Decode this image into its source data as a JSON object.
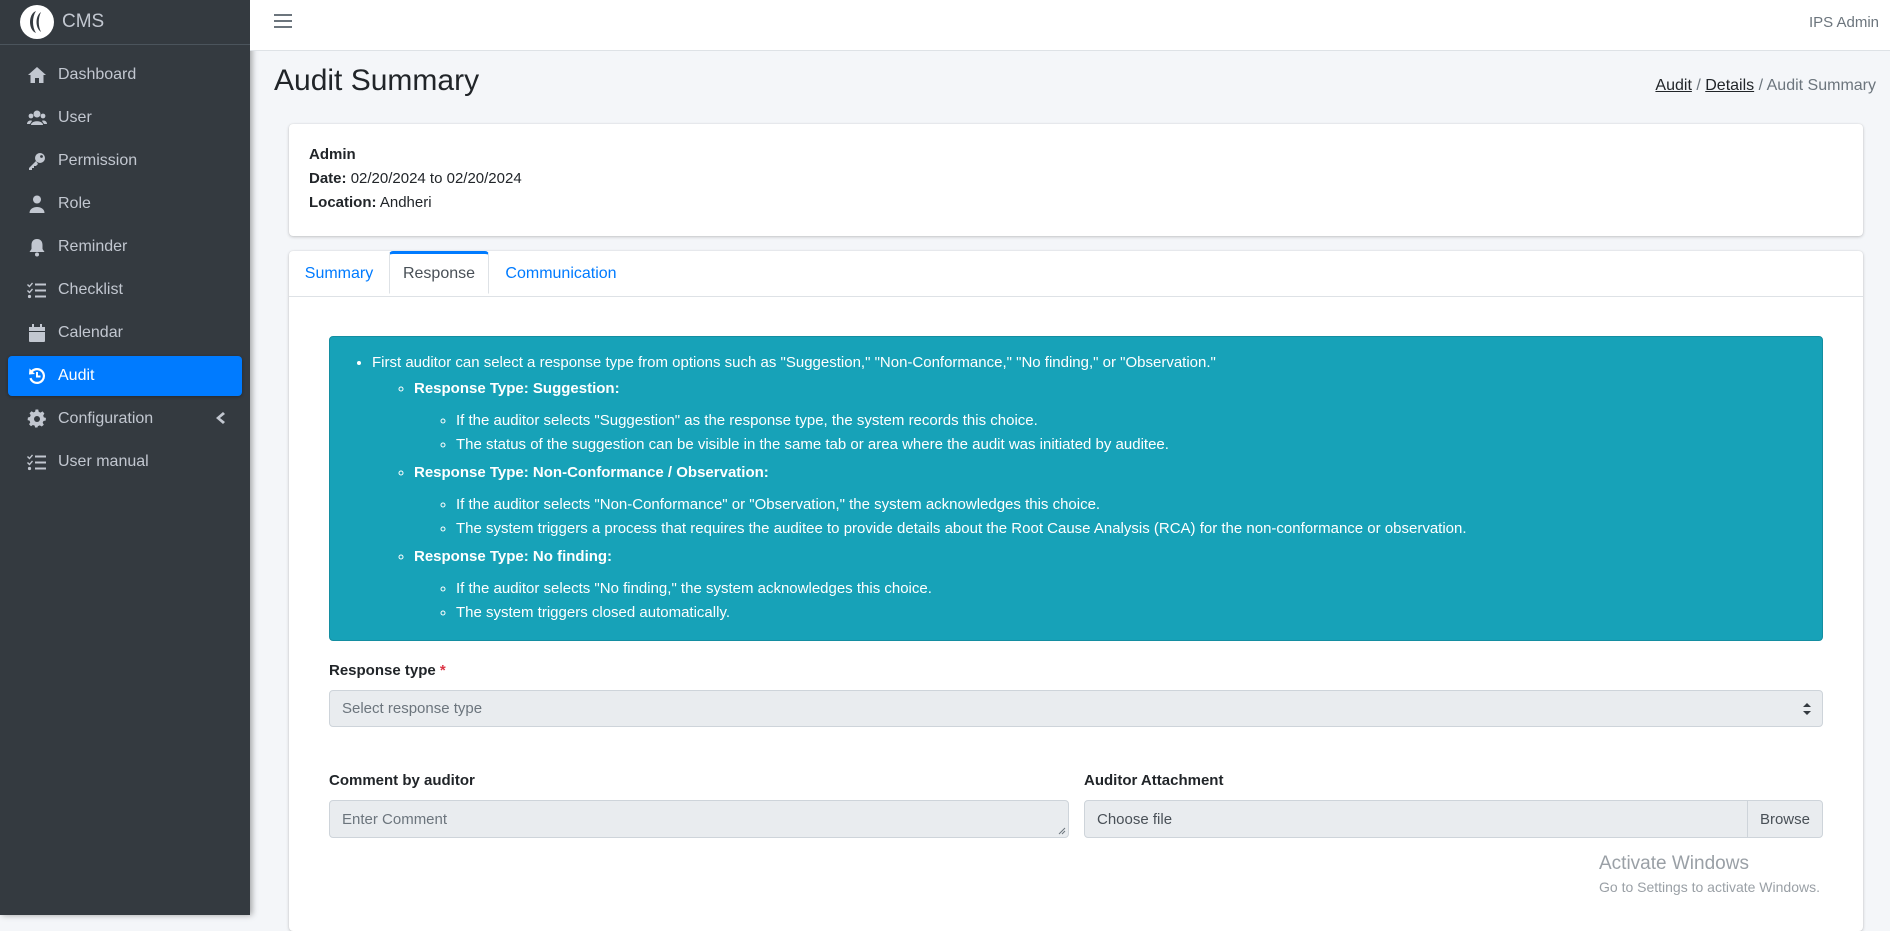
{
  "brand": {
    "name": "CMS"
  },
  "sidebar": {
    "items": [
      {
        "label": "Dashboard",
        "icon": "home-icon"
      },
      {
        "label": "User",
        "icon": "users-icon"
      },
      {
        "label": "Permission",
        "icon": "key-icon"
      },
      {
        "label": "Role",
        "icon": "user-icon"
      },
      {
        "label": "Reminder",
        "icon": "bell-icon"
      },
      {
        "label": "Checklist",
        "icon": "list-check-icon"
      },
      {
        "label": "Calendar",
        "icon": "calendar-icon"
      },
      {
        "label": "Audit",
        "icon": "history-icon",
        "active": true
      },
      {
        "label": "Configuration",
        "icon": "gear-icon"
      },
      {
        "label": "User manual",
        "icon": "list-check-icon"
      }
    ]
  },
  "header": {
    "user": "IPS Admin"
  },
  "page": {
    "title": "Audit Summary",
    "breadcrumb": {
      "audit": "Audit",
      "sep1": "/",
      "details": "Details",
      "sep2": "/",
      "current": "Audit Summary"
    }
  },
  "info": {
    "name": "Admin",
    "date_label": "Date:",
    "date_value": "02/20/2024 to 02/20/2024",
    "location_label": "Location:",
    "location_value": "Andheri"
  },
  "tabs": {
    "summary": "Summary",
    "response": "Response",
    "communication": "Communication"
  },
  "alert": {
    "intro": "First auditor can select a response type from options such as \"Suggestion,\" \"Non-Conformance,\" \"No finding,\" or \"Observation.\"",
    "suggestion": {
      "title": "Response Type: Suggestion:",
      "p1": "If the auditor selects \"Suggestion\" as the response type, the system records this choice.",
      "p2": "The status of the suggestion can be visible in the same tab or area where the audit was initiated by auditee."
    },
    "nonconformance": {
      "title": "Response Type: Non-Conformance / Observation:",
      "p1": "If the auditor selects \"Non-Conformance\" or \"Observation,\" the system acknowledges this choice.",
      "p2": "The system triggers a process that requires the auditee to provide details about the Root Cause Analysis (RCA) for the non-conformance or observation."
    },
    "nofinding": {
      "title": "Response Type: No finding:",
      "p1": "If the auditor selects \"No finding,\" the system acknowledges this choice.",
      "p2": "The system triggers closed automatically."
    }
  },
  "form": {
    "response_type_label": "Response type",
    "required_mark": "*",
    "response_type_placeholder": "Select response type",
    "comment_label": "Comment by auditor",
    "comment_placeholder": "Enter Comment",
    "attachment_label": "Auditor Attachment",
    "attachment_text": "Choose file",
    "browse_label": "Browse"
  },
  "watermark": {
    "line1": "Activate Windows",
    "line2": "Go to Settings to activate Windows."
  },
  "colors": {
    "sidebar": "#343a40",
    "active": "#007bff",
    "alert": "#17a2b8"
  }
}
